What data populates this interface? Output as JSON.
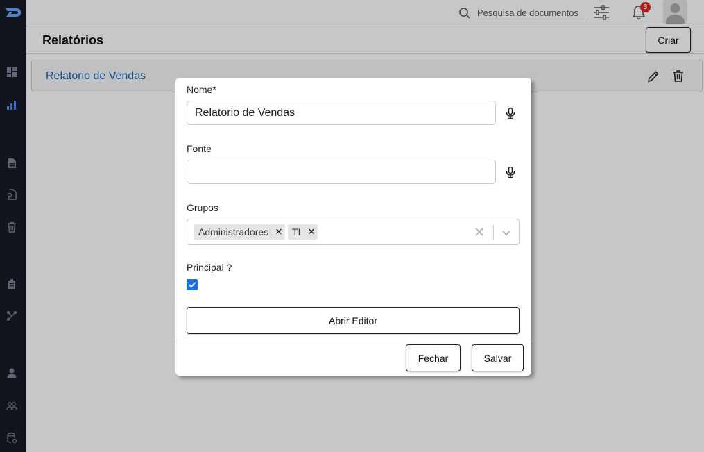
{
  "header": {
    "search_placeholder": "Pesquisa de documentos",
    "notification_count": "3"
  },
  "page": {
    "title": "Relatórios",
    "create_label": "Criar",
    "reports": [
      {
        "name": "Relatorio de Vendas"
      }
    ]
  },
  "modal": {
    "name_label": "Nome*",
    "name_value": "Relatorio de Vendas",
    "source_label": "Fonte",
    "source_value": "",
    "groups_label": "Grupos",
    "groups": [
      "Administradores",
      "TI"
    ],
    "principal_label": "Principal ?",
    "principal_checked": true,
    "open_editor_label": "Abrir Editor",
    "close_label": "Fechar",
    "save_label": "Salvar"
  },
  "colors": {
    "sidebar_bg": "#161b26",
    "link_blue": "#1a5fb4",
    "checkbox_blue": "#1a73e8",
    "badge_red": "#e02424"
  },
  "icons": {
    "sidebar": [
      "dashboard-icon",
      "chart-icon",
      "document-icon",
      "file-settings-icon",
      "trash-icon",
      "clipboard-icon",
      "workflow-icon",
      "user-icon",
      "users-icon",
      "database-icon"
    ],
    "topbar": [
      "search-icon",
      "filter-icon",
      "bell-icon",
      "avatar-icon"
    ]
  }
}
